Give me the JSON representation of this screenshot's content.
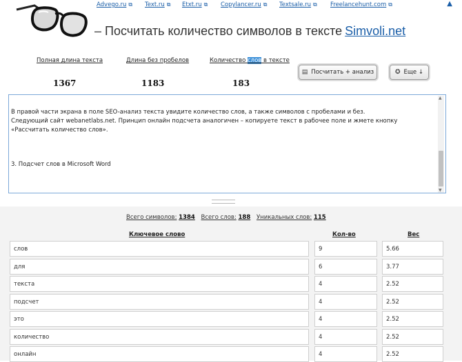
{
  "top_links": [
    "Advego.ru",
    "Text.ru",
    "Etxt.ru",
    "Copylancer.ru",
    "Textsale.ru",
    "Freelancehunt.com"
  ],
  "top_arrow": "▲",
  "header": {
    "title": "– Посчитать количество символов в тексте",
    "site_name": "Simvoli.net"
  },
  "stats": {
    "total_label": "Полная длина текста",
    "total_value": "1367",
    "nospace_label": "Длина без пробелов",
    "nospace_value": "1183",
    "words_label_pre": "Количество ",
    "words_label_highlight": "слов",
    "words_label_post": " в тексте",
    "words_value": "183"
  },
  "buttons": {
    "analyze_label": "Посчитать + анализ",
    "more_label": "Еще ↓"
  },
  "editor": {
    "lines": [
      "В правой части экрана в поле SEO-анализ текста увидите количество слов, а также символов с пробелами и без.",
      "Следующий сайт webanetlabs.net. Принцип онлайн подсчета аналогичен – копируете текст в рабочее поле и жмете кнопку «Рассчитать количество слов»."
    ],
    "line3": "3. Подсчет слов в Microsoft Word"
  },
  "summary": {
    "chars_label": "Всего символов:",
    "chars_value": "1384",
    "words_label": "Всего слов:",
    "words_value": "188",
    "unique_label": "Уникальных слов:",
    "unique_value": "115"
  },
  "table": {
    "headers": [
      "Ключевое слово",
      "Кол-во",
      "Вес"
    ],
    "rows": [
      [
        "слов",
        "9",
        "5.66"
      ],
      [
        "для",
        "6",
        "3.77"
      ],
      [
        "текста",
        "4",
        "2.52"
      ],
      [
        "подсчет",
        "4",
        "2.52"
      ],
      [
        "это",
        "4",
        "2.52"
      ],
      [
        "количество",
        "4",
        "2.52"
      ],
      [
        "онлайн",
        "4",
        "2.52"
      ]
    ]
  }
}
